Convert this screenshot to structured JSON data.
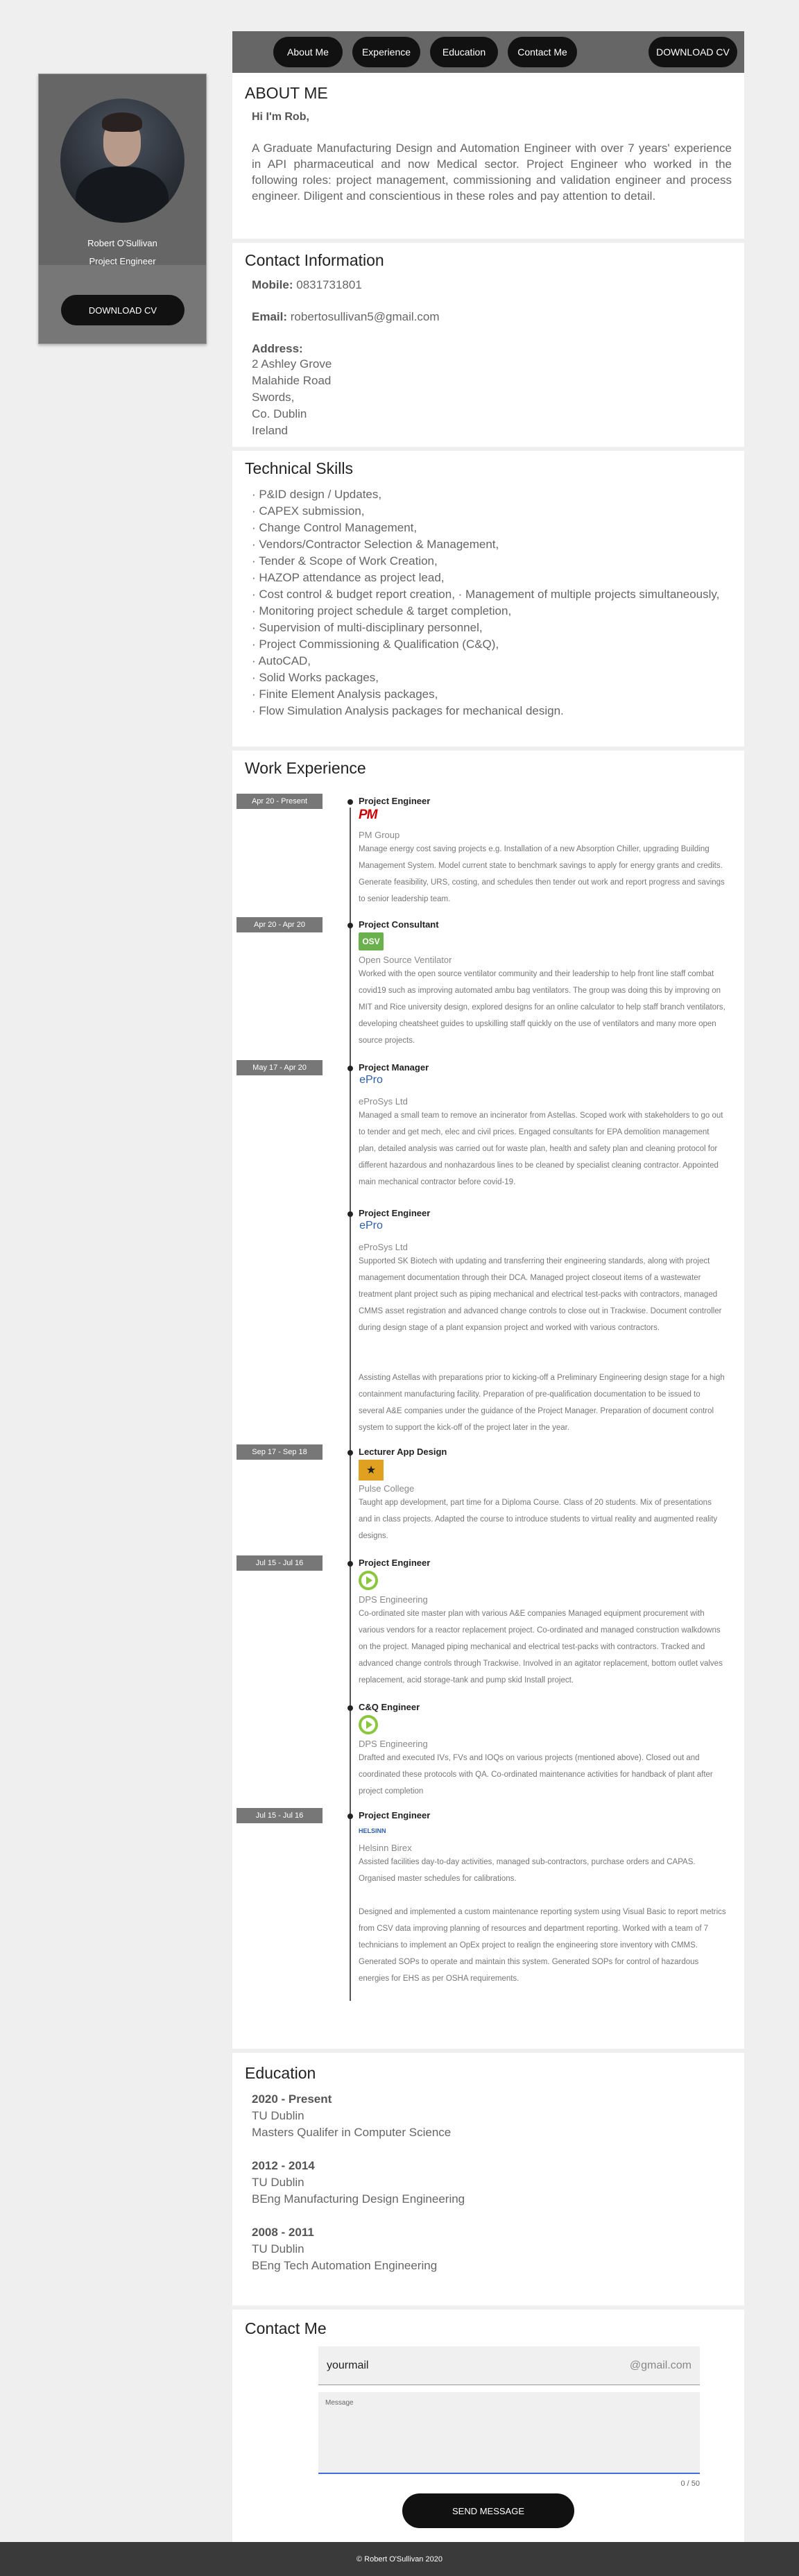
{
  "profile": {
    "name": "Robert O'Sullivan",
    "role": "Project Engineer",
    "download_label": "DOWNLOAD CV"
  },
  "nav": {
    "items": [
      "About Me",
      "Experience",
      "Education",
      "Contact Me"
    ],
    "download_label": "DOWNLOAD CV"
  },
  "about": {
    "heading": "ABOUT ME",
    "greeting": "Hi I'm Rob,",
    "text": "A Graduate Manufacturing Design and Automation Engineer with over 7 years' experience in API pharmaceutical and now Medical sector. Project Engineer who worked in the following roles: project management, commissioning and validation engineer and process engineer. Diligent and conscientious in these roles and pay attention to detail."
  },
  "contact_info": {
    "heading": "Contact Information",
    "mobile_label": "Mobile:",
    "mobile": "0831731801",
    "email_label": "Email:",
    "email": "robertosullivan5@gmail.com",
    "address_label": "Address:",
    "address": [
      "2 Ashley Grove",
      "Malahide Road",
      "Swords,",
      "Co. Dublin",
      "Ireland"
    ]
  },
  "skills": {
    "heading": "Technical Skills",
    "items": [
      "· P&ID design / Updates,",
      "· CAPEX submission,",
      "· Change Control Management,",
      "· Vendors/Contractor Selection & Management,",
      "· Tender & Scope of Work Creation,",
      "· HAZOP attendance as project lead,",
      "· Cost control & budget report creation, · Management of multiple projects simultaneously,",
      "· Monitoring project schedule & target completion,",
      "· Supervision of multi-disciplinary personnel,",
      "· Project Commissioning & Qualification (C&Q),",
      "· AutoCAD,",
      "· Solid Works packages,",
      "· Finite Element Analysis packages,",
      "· Flow Simulation Analysis packages for mechanical design."
    ]
  },
  "work": {
    "heading": "Work Experience",
    "jobs": [
      {
        "date": "Apr 20 - Present",
        "title": "Project Engineer",
        "logo": "PM",
        "company": "PM Group",
        "description": "Manage energy cost saving projects e.g. Installation of a new Absorption Chiller, upgrading Building Management System. Model current state to benchmark savings to apply for energy grants and credits. Generate feasibility, URS, costing, and schedules then tender out work and report progress and savings to senior leadership team."
      },
      {
        "date": "Apr 20 - Apr 20",
        "title": "Project Consultant",
        "logo": "OSV",
        "company": "Open Source Ventilator",
        "description": "Worked with the open source ventilator community and their leadership to help front line staff combat covid19 such as improving automated ambu bag ventilators. The group was doing this by improving on MIT and Rice university design, explored designs for an online calculator to help staff branch ventilators, developing cheatsheet guides to upskilling staff quickly on the use of ventilators and many more open source projects."
      },
      {
        "date": "May 17 - Apr 20",
        "title": "Project Manager",
        "logo": "ePro",
        "company": "eProSys Ltd",
        "description": "Managed a small team to remove an incinerator from Astellas. Scoped work with stakeholders to go out to tender and get mech, elec and civil prices. Engaged consultants for EPA demolition management plan, detailed analysis was carried out for waste plan, health and safety plan and cleaning protocol for different hazardous and nonhazardous lines to be cleaned by specialist cleaning contractor. Appointed main mechanical contractor before covid-19."
      },
      {
        "date": "",
        "title": "Project Engineer",
        "logo": "ePro",
        "company": "eProSys Ltd",
        "description": "Supported SK Biotech with updating and transferring their engineering standards, along with project management documentation through their DCA. Managed project closeout items of a wastewater treatment plant project such as piping mechanical and electrical test-packs with contractors, managed CMMS asset registration and advanced change controls to close out in Trackwise. Document controller during design stage of a plant expansion project and worked with various contractors.",
        "description2": "Assisting Astellas with preparations prior to kicking-off a Preliminary Engineering design stage for a high containment manufacturing facility. Preparation of pre-qualification documentation to be issued to several A&E companies under the guidance of the Project Manager. Preparation of document control system to support the kick-off of the project later in the year."
      },
      {
        "date": "Sep 17 - Sep 18",
        "title": "Lecturer App Design",
        "logo": "★",
        "company": "Pulse College",
        "description": "Taught app development, part time for a Diploma Course. Class of 20 students. Mix of presentations and in class projects. Adapted the course to introduce students to virtual reality and augmented reality designs."
      },
      {
        "date": "Jul 15 - Jul 16",
        "title": "Project Engineer",
        "logo": "DPS",
        "company": "DPS Engineering",
        "description": "Co-ordinated site master plan with various A&E companies     Managed equipment procurement with various vendors for a reactor replacement project. Co-ordinated and managed construction walkdowns on the project. Managed piping mechanical and electrical test-packs with contractors. Tracked and advanced change controls through Trackwise. Involved in an agitator replacement, bottom outlet valves replacement, acid storage-tank and pump skid Install project."
      },
      {
        "date": "",
        "title": "C&Q Engineer",
        "logo": "DPS",
        "company": "DPS Engineering",
        "description": "Drafted and executed IVs, FVs and IOQs on various projects (mentioned above). Closed out and coordinated these protocols with QA. Co-ordinated maintenance activities for handback of plant after project completion"
      },
      {
        "date": "Jul 15 - Jul 16",
        "title": "Project Engineer",
        "logo": "HELSINN",
        "company": "Helsinn Birex",
        "description": "Assisted facilities day-to-day activities, managed sub-contractors, purchase orders and CAPAS. Organised master schedules for calibrations.",
        "description2": "Designed and implemented a custom maintenance reporting system using Visual Basic to report metrics from CSV data improving planning of resources and department reporting. Worked with a team of 7 technicians to implement an OpEx project to realign the engineering store inventory with CMMS. Generated SOPs to operate and maintain this system. Generated SOPs for control of hazardous energies for EHS as per OSHA requirements."
      }
    ]
  },
  "education": {
    "heading": "Education",
    "entries": [
      {
        "year": "2020 - Present",
        "school": "TU Dublin",
        "degree": "Masters Qualifer in Computer Science"
      },
      {
        "year": "2012 - 2014",
        "school": "TU Dublin",
        "degree": "BEng Manufacturing Design Engineering"
      },
      {
        "year": "2008 - 2011",
        "school": "TU Dublin",
        "degree": "BEng Tech Automation Engineering"
      }
    ]
  },
  "contact_form": {
    "heading": "Contact Me",
    "email_value": "yourmail",
    "email_suffix": "@gmail.com",
    "message_label": "Message",
    "char_count": "0 / 50",
    "send_label": "SEND MESSAGE"
  },
  "footer": {
    "text": "© Robert O'Sullivan 2020"
  }
}
